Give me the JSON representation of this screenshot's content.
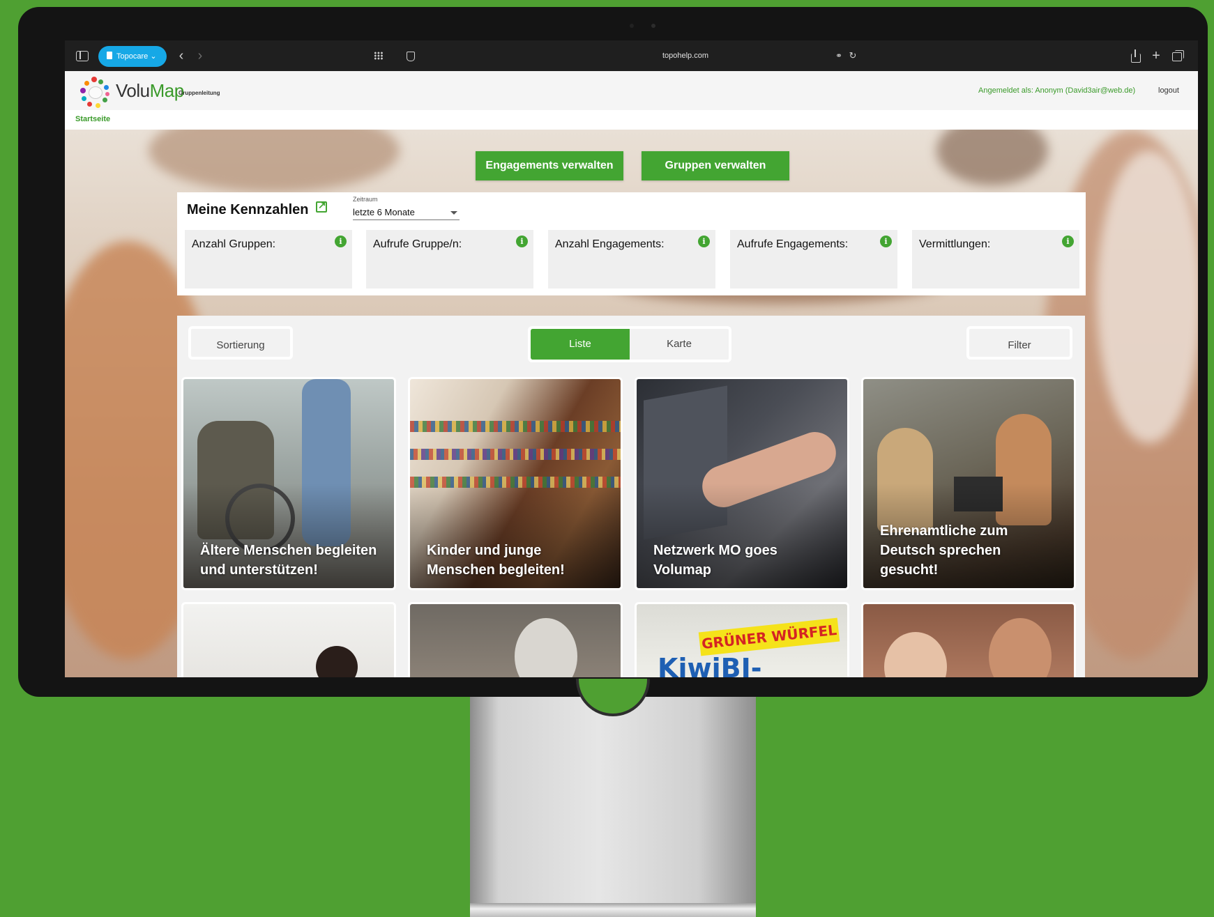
{
  "browser": {
    "tab_group": "Topocare",
    "url": "topohelp.com"
  },
  "header": {
    "logo_main": "Volu",
    "logo_map": "Map",
    "logo_sub": "Gruppenleitung",
    "user_label": "Angemeldet als: Anonym (David3air@web.de)",
    "logout": "logout"
  },
  "breadcrumb": "Startseite",
  "actions": {
    "engagements": "Engagements verwalten",
    "groups": "Gruppen verwalten"
  },
  "kennzahlen": {
    "title": "Meine Kennzahlen",
    "zeitraum_label": "Zeitraum",
    "zeitraum_value": "letzte 6 Monate",
    "cards": [
      {
        "label": "Anzahl Gruppen:"
      },
      {
        "label": "Aufrufe Gruppe/n:"
      },
      {
        "label": "Anzahl Engagements:"
      },
      {
        "label": "Aufrufe Engagements:"
      },
      {
        "label": "Vermittlungen:"
      }
    ]
  },
  "toolbar": {
    "sort": "Sortierung",
    "list": "Liste",
    "map": "Karte",
    "filter": "Filter"
  },
  "cards": [
    {
      "title": "Ältere Menschen begleiten und unterstützen!"
    },
    {
      "title": "Kinder und junge Menschen begleiten!"
    },
    {
      "title": "Netzwerk MO goes Volumap"
    },
    {
      "title": "Ehrenamtliche zum Deutsch sprechen gesucht!"
    }
  ],
  "card_row2": {
    "banner_top": "GRÜNER WÜRFEL",
    "banner_bottom": "KiwiBI-TREFF"
  },
  "colors": {
    "accent": "#43a532",
    "background": "#4fa032",
    "tab_group": "#16a8e6"
  }
}
